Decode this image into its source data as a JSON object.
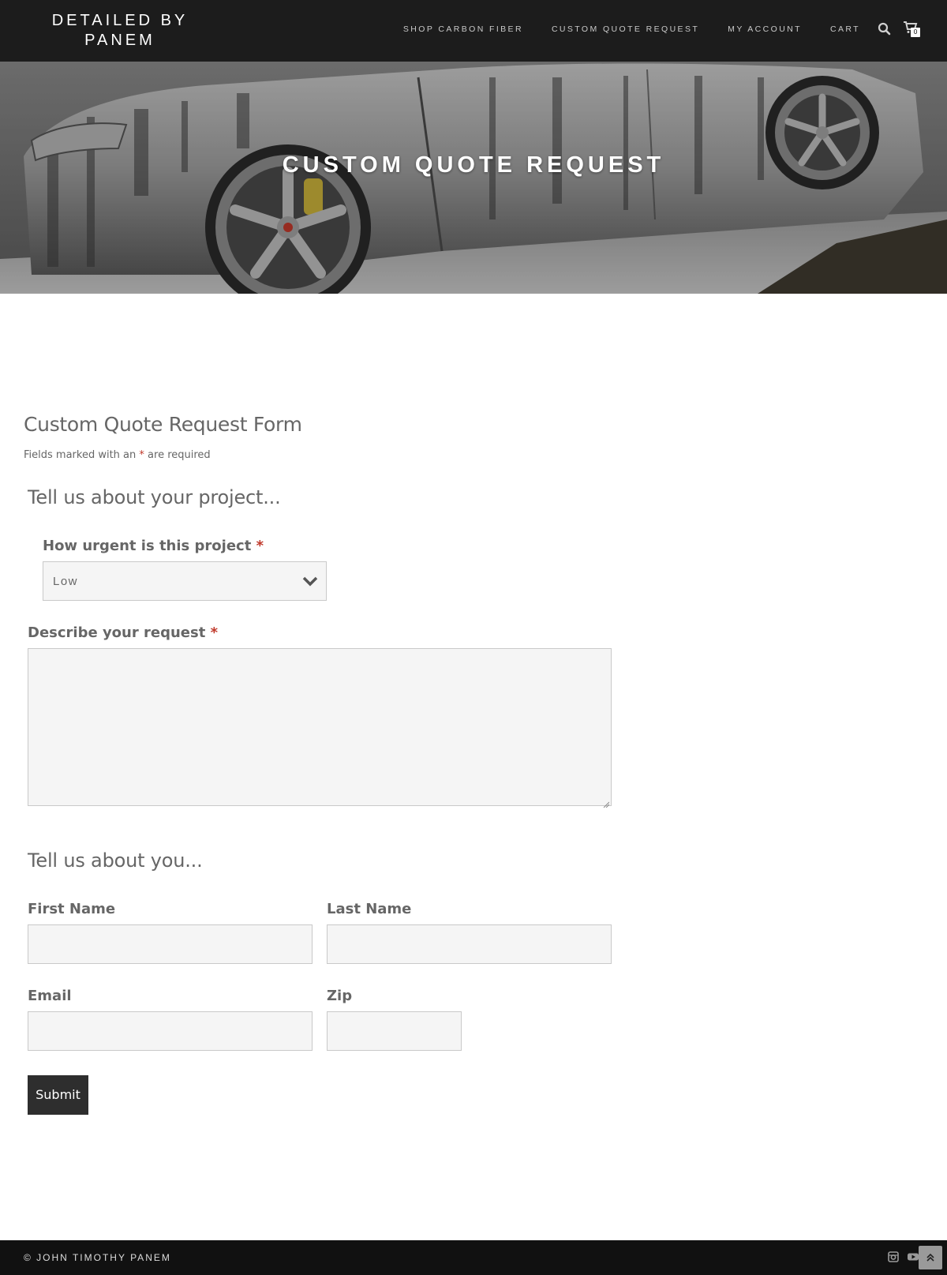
{
  "header": {
    "logo": "DETAILED BY PANEM",
    "nav": [
      {
        "label": "SHOP CARBON FIBER"
      },
      {
        "label": "CUSTOM QUOTE REQUEST"
      },
      {
        "label": "MY ACCOUNT"
      },
      {
        "label": "CART"
      }
    ],
    "search_icon": "search-icon",
    "cart_icon": "shopping-cart-icon",
    "cart_count": "0"
  },
  "hero": {
    "title": "CUSTOM QUOTE REQUEST"
  },
  "form": {
    "title": "Custom Quote Request Form",
    "required_note_prefix": "Fields marked with an",
    "required_note_star": "*",
    "required_note_suffix": "are required",
    "section1_heading": "Tell us about your project...",
    "urgency_label": "How urgent is this project",
    "urgency_value": "Low",
    "urgency_options": [
      "Low"
    ],
    "description_label": "Describe your request",
    "description_value": "",
    "section2_heading": "Tell us about you...",
    "first_name_label": "First Name",
    "first_name_value": "",
    "last_name_label": "Last Name",
    "last_name_value": "",
    "email_label": "Email",
    "email_value": "",
    "zip_label": "Zip",
    "zip_value": "",
    "required_star": "*",
    "submit_label": "Submit"
  },
  "footer": {
    "copyright": "© JOHN TIMOTHY PANEM",
    "social": [
      "instagram-icon",
      "youtube-icon"
    ],
    "back_to_top_icon": "double-chevron-up-icon"
  },
  "colors": {
    "header_bg": "#1c1c1c",
    "footer_bg": "#111111",
    "accent_required": "#c0392b",
    "button_bg": "#2e2e2e",
    "input_bg": "#f5f5f5"
  }
}
